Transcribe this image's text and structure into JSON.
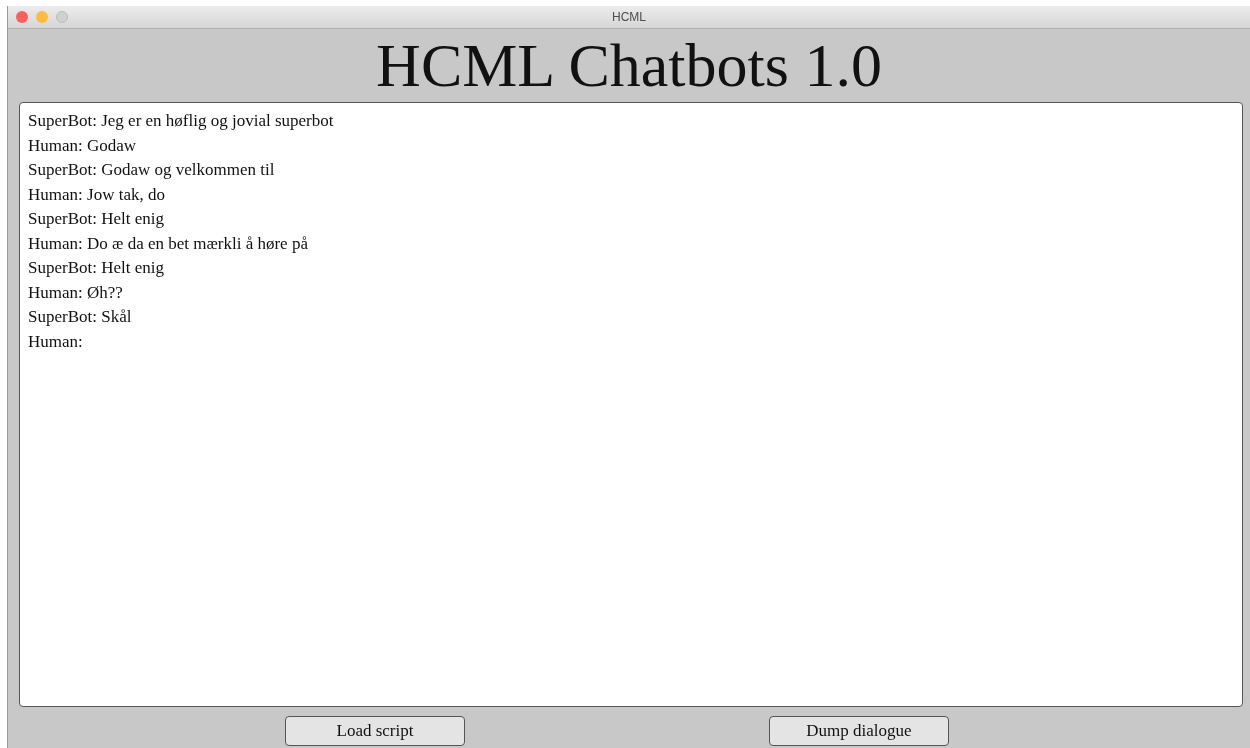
{
  "window": {
    "title": "HCML"
  },
  "heading": "HCML Chatbots 1.0",
  "dialogue": [
    "SuperBot: Jeg er en høflig og jovial superbot",
    "Human: Godaw",
    "SuperBot: Godaw og velkommen til",
    "Human: Jow tak, do",
    "SuperBot: Helt enig",
    "Human: Do æ da en bet mærkli å høre på",
    "SuperBot: Helt enig",
    "Human: Øh??",
    "SuperBot: Skål",
    "Human:"
  ],
  "buttons": [
    "Load script",
    "Dump dialogue"
  ]
}
